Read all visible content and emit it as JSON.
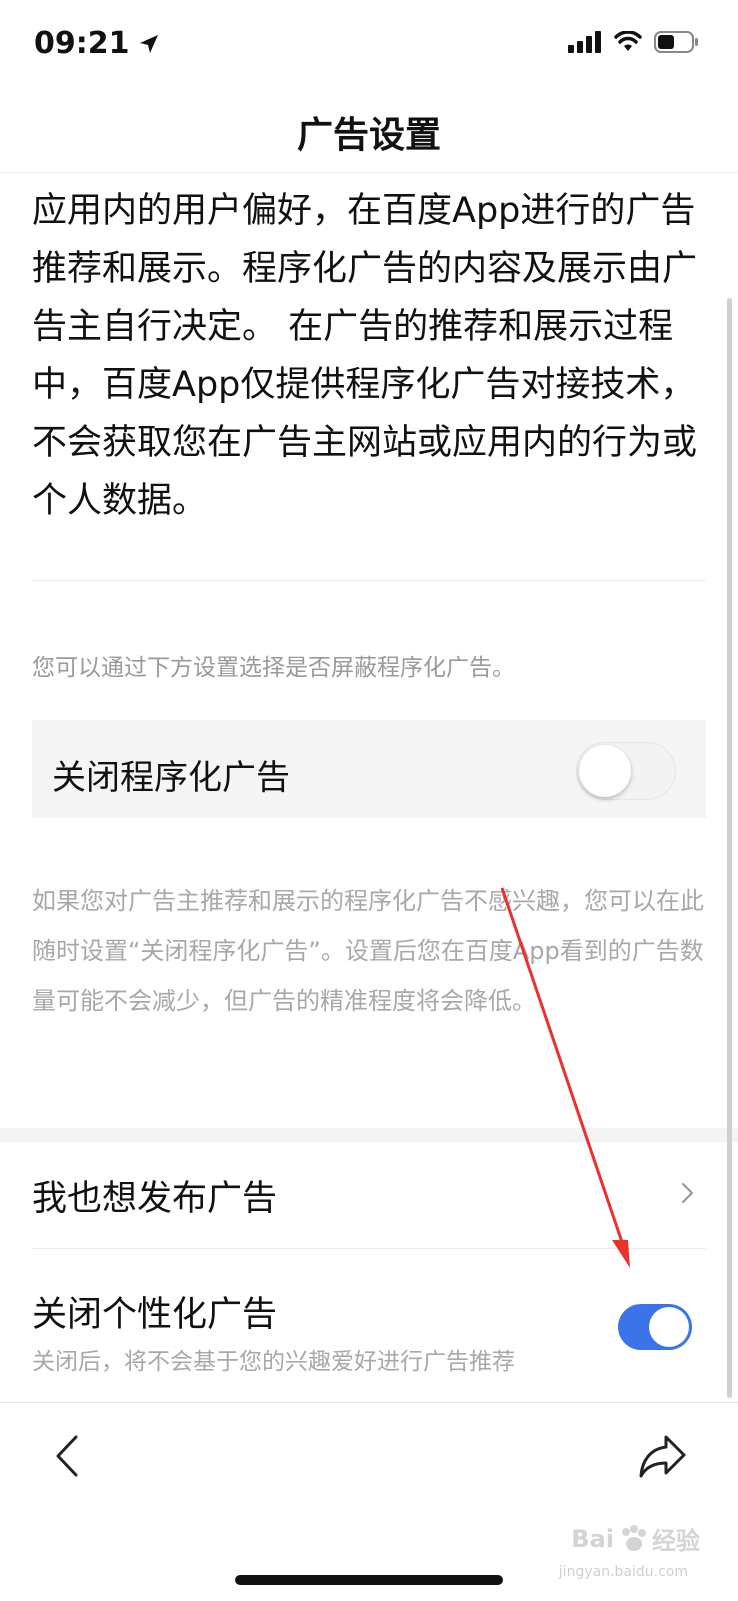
{
  "status_bar": {
    "time": "09:21",
    "icons": [
      "location-arrow-icon",
      "cellular-signal-icon",
      "wifi-icon",
      "battery-icon"
    ]
  },
  "nav": {
    "title": "广告设置"
  },
  "intro": {
    "text": "应用内的用户偏好，在百度App进行的广告推荐和展示。程序化广告的内容及展示由广告主自行决定。 在广告的推荐和展示过程中，百度App仅提供程序化广告对接技术，不会获取您在广告主网站或应用内的行为或个人数据。"
  },
  "hint": {
    "text": "您可以通过下方设置选择是否屏蔽程序化广告。"
  },
  "programmatic_ads": {
    "label": "关闭程序化广告",
    "enabled": false
  },
  "programmatic_desc": {
    "text": "如果您对广告主推荐和展示的程序化广告不感兴趣，您可以在此随时设置“关闭程序化广告”。设置后您在百度App看到的广告数量可能不会减少，但广告的精准程度将会降低。"
  },
  "list": {
    "publish_ads": {
      "label": "我也想发布广告",
      "icon": "chevron-right-icon"
    },
    "personalized_ads": {
      "label": "关闭个性化广告",
      "sublabel": "关闭后，将不会基于您的兴趣爱好进行广告推荐",
      "enabled": true
    }
  },
  "bottom_bar": {
    "back_icon": "back-chevron-icon",
    "share_icon": "share-arrow-icon"
  },
  "watermark": {
    "brand": "Bai",
    "brand2": "经验",
    "domain": "jingyan.baidu.com"
  },
  "colors": {
    "toggle_on": "#3a74e8",
    "annotation_arrow": "#e8322b",
    "hint_text": "#9a9a9a"
  }
}
